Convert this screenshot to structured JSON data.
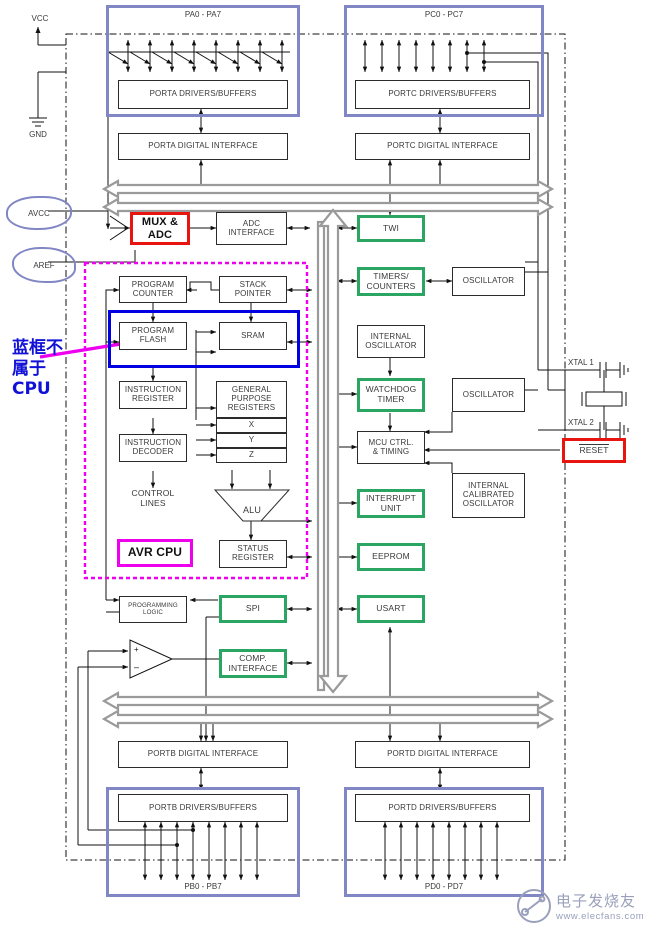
{
  "diagram": {
    "title": "AVR Microcontroller Block Diagram",
    "colors": {
      "port_boundary_blue": "#8186c4",
      "highlight_blue": "#0000e0",
      "highlight_red": "#e8140f",
      "highlight_green": "#2aa662",
      "highlight_magenta": "#ee00ee",
      "bus_gray": "#9a9a9a",
      "annotation_blue": "#1111d8"
    }
  },
  "power_pins": {
    "vcc": "VCC",
    "gnd": "GND",
    "avcc": "AVCC",
    "aref": "AREF"
  },
  "port_groups": [
    {
      "name": "porta",
      "pin_label": "PA0 - PA7",
      "drivers": "PORTA DRIVERS/BUFFERS",
      "digital_interface": "PORTA DIGITAL INTERFACE",
      "pins": 8
    },
    {
      "name": "portc",
      "pin_label": "PC0 - PC7",
      "drivers": "PORTC DRIVERS/BUFFERS",
      "digital_interface": "PORTC DIGITAL INTERFACE",
      "pins": 8
    },
    {
      "name": "portb",
      "pin_label": "PB0 - PB7",
      "drivers": "PORTB DRIVERS/BUFFERS",
      "digital_interface": "PORTB DIGITAL INTERFACE",
      "pins": 8
    },
    {
      "name": "portd",
      "pin_label": "PD0 - PD7",
      "drivers": "PORTD DRIVERS/BUFFERS",
      "digital_interface": "PORTD DIGITAL INTERFACE",
      "pins": 8
    }
  ],
  "analog": {
    "mux_adc": "MUX &\nADC",
    "mux_adc_line1": "MUX &",
    "mux_adc_line2": "ADC",
    "adc_interface_line1": "ADC",
    "adc_interface_line2": "INTERFACE",
    "comparator": "analog-comparator",
    "comp_plus": "+",
    "comp_minus": "–"
  },
  "cpu": {
    "boundary_label": "AVR CPU",
    "blocks": [
      {
        "id": "program-counter",
        "line1": "PROGRAM",
        "line2": "COUNTER"
      },
      {
        "id": "stack-pointer",
        "line1": "STACK",
        "line2": "POINTER"
      },
      {
        "id": "program-flash",
        "line1": "PROGRAM",
        "line2": "FLASH"
      },
      {
        "id": "sram",
        "line1": "SRAM",
        "line2": ""
      },
      {
        "id": "instruction-register",
        "line1": "INSTRUCTION",
        "line2": "REGISTER"
      },
      {
        "id": "general-purpose-registers",
        "line1": "GENERAL",
        "line2": "PURPOSE",
        "line3": "REGISTERS"
      },
      {
        "id": "instruction-decoder",
        "line1": "INSTRUCTION",
        "line2": "DECODER"
      },
      {
        "id": "control-lines",
        "line1": "CONTROL",
        "line2": "LINES"
      },
      {
        "id": "alu",
        "line1": "ALU",
        "line2": ""
      },
      {
        "id": "status-register",
        "line1": "STATUS",
        "line2": "REGISTER"
      }
    ],
    "index_registers": [
      "X",
      "Y",
      "Z"
    ]
  },
  "peripherals": [
    {
      "id": "twi",
      "line1": "TWI",
      "line2": "",
      "style": "green"
    },
    {
      "id": "timers-counters",
      "line1": "TIMERS/",
      "line2": "COUNTERS",
      "style": "green"
    },
    {
      "id": "oscillator-timer",
      "line1": "OSCILLATOR",
      "line2": "",
      "style": "plain"
    },
    {
      "id": "internal-oscillator",
      "line1": "INTERNAL",
      "line2": "OSCILLATOR",
      "style": "plain"
    },
    {
      "id": "watchdog-timer",
      "line1": "WATCHDOG",
      "line2": "TIMER",
      "style": "green"
    },
    {
      "id": "oscillator-xtal",
      "line1": "OSCILLATOR",
      "line2": "",
      "style": "plain"
    },
    {
      "id": "mcu-ctrl-timing",
      "line1": "MCU CTRL.",
      "line2": "& TIMING",
      "style": "plain"
    },
    {
      "id": "interrupt-unit",
      "line1": "INTERRUPT",
      "line2": "UNIT",
      "style": "green"
    },
    {
      "id": "internal-calibrated-oscillator",
      "line1": "INTERNAL",
      "line2": "CALIBRATED",
      "line3": "OSCILLATOR",
      "style": "plain"
    },
    {
      "id": "eeprom",
      "line1": "EEPROM",
      "line2": "",
      "style": "green"
    },
    {
      "id": "usart",
      "line1": "USART",
      "line2": "",
      "style": "green"
    },
    {
      "id": "spi",
      "line1": "SPI",
      "line2": "",
      "style": "green"
    },
    {
      "id": "comp-interface",
      "line1": "COMP.",
      "line2": "INTERFACE",
      "style": "green"
    },
    {
      "id": "programming-logic",
      "line1": "PROGRAMMING",
      "line2": "LOGIC",
      "style": "plain"
    }
  ],
  "clock_reset": {
    "xtal1": "XTAL 1",
    "xtal2": "XTAL 2",
    "reset": "RESET",
    "reset_active_low": true
  },
  "annotation": {
    "chinese_line1": "蓝框不",
    "chinese_line2": "属于",
    "chinese_line3": "CPU",
    "arrow_target": "program-flash",
    "arrow_color": "#ee00ee"
  },
  "watermark": {
    "text_cn": "电子发烧友",
    "text_url": "www.elecfans.com"
  }
}
